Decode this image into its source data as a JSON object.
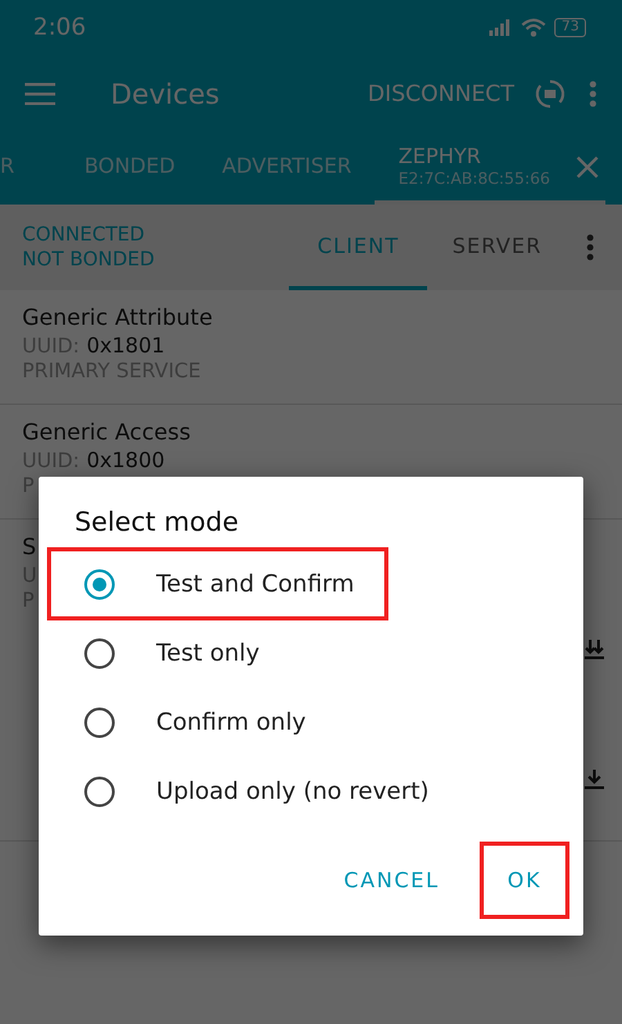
{
  "status_bar": {
    "time": "2:06",
    "battery": "73"
  },
  "app_bar": {
    "title": "Devices",
    "action": "DISCONNECT"
  },
  "tabs": [
    {
      "label": "R",
      "selected": false
    },
    {
      "label": "BONDED",
      "selected": false
    },
    {
      "label": "ADVERTISER",
      "selected": false
    },
    {
      "label": "ZEPHYR",
      "subtitle": "E2:7C:AB:8C:55:66",
      "selected": true
    }
  ],
  "connection": {
    "state": "CONNECTED",
    "bond": "NOT BONDED"
  },
  "sub_tabs": [
    {
      "label": "CLIENT",
      "selected": true
    },
    {
      "label": "SERVER",
      "selected": false
    }
  ],
  "services": [
    {
      "name": "Generic Attribute",
      "uuid_label": "UUID:",
      "uuid": "0x1801",
      "type": "PRIMARY SERVICE",
      "actions": false
    },
    {
      "name": "Generic Access",
      "uuid_label": "UUID:",
      "uuid": "0x1800",
      "type": "P",
      "actions": false
    },
    {
      "name": "S",
      "uuid_label": "U",
      "type": "P",
      "actions": true
    }
  ],
  "dialog": {
    "title": "Select mode",
    "options": [
      {
        "label": "Test and Confirm",
        "selected": true,
        "highlighted": true
      },
      {
        "label": "Test only",
        "selected": false,
        "highlighted": false
      },
      {
        "label": "Confirm only",
        "selected": false,
        "highlighted": false
      },
      {
        "label": "Upload only (no revert)",
        "selected": false,
        "highlighted": false
      }
    ],
    "buttons": [
      {
        "label": "CANCEL",
        "highlighted": false
      },
      {
        "label": "OK",
        "highlighted": true
      }
    ]
  }
}
